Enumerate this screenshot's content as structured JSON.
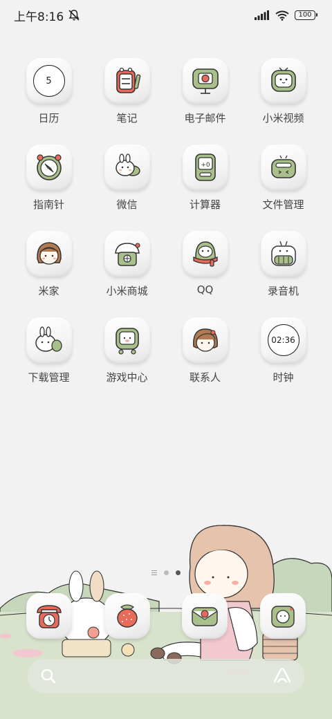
{
  "status_bar": {
    "time": "上午8:16",
    "battery": "100",
    "icons": [
      "mute-bell-icon",
      "signal-icon",
      "wifi-icon",
      "battery-icon"
    ]
  },
  "apps": [
    {
      "label": "日历",
      "icon": "calendar-icon",
      "face": "5"
    },
    {
      "label": "笔记",
      "icon": "notes-icon"
    },
    {
      "label": "电子邮件",
      "icon": "email-icon"
    },
    {
      "label": "小米视频",
      "icon": "video-icon"
    },
    {
      "label": "指南针",
      "icon": "compass-icon"
    },
    {
      "label": "微信",
      "icon": "wechat-icon"
    },
    {
      "label": "计算器",
      "icon": "calculator-icon",
      "face": "+0"
    },
    {
      "label": "文件管理",
      "icon": "file-manager-icon"
    },
    {
      "label": "米家",
      "icon": "mijia-icon"
    },
    {
      "label": "小米商城",
      "icon": "mi-store-icon"
    },
    {
      "label": "QQ",
      "icon": "qq-icon"
    },
    {
      "label": "录音机",
      "icon": "recorder-icon"
    },
    {
      "label": "下载管理",
      "icon": "download-icon"
    },
    {
      "label": "游戏中心",
      "icon": "game-center-icon"
    },
    {
      "label": "联系人",
      "icon": "contacts-icon"
    },
    {
      "label": "时钟",
      "icon": "clock-icon",
      "face": "02:36"
    }
  ],
  "page_indicator": {
    "pages": 2,
    "active": 1
  },
  "dock": [
    {
      "icon": "phone-icon"
    },
    {
      "icon": "browser-icon"
    },
    {
      "icon": "messages-icon"
    },
    {
      "icon": "camera-icon"
    }
  ],
  "search_bar": {
    "left_icon": "search-icon",
    "right_icon": "assistant-icon"
  },
  "colors": {
    "background": "#f2f2f2",
    "accent_green": "#a9c08a",
    "accent_red": "#e86a5a",
    "tile": "#f7f7f7"
  }
}
